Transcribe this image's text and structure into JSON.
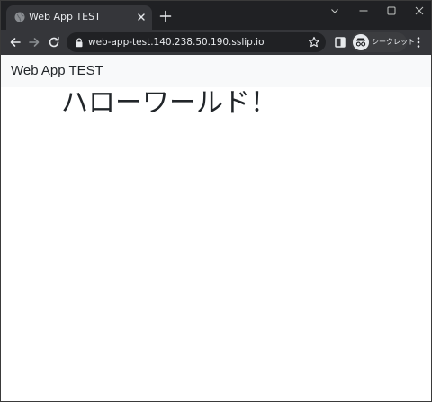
{
  "browser": {
    "tab": {
      "title": "Web App TEST",
      "favicon": "globe-icon"
    },
    "address_bar": {
      "url": "web-app-test.140.238.50.190.sslip.io"
    },
    "profile": {
      "label": "シークレット",
      "icon": "incognito-icon"
    },
    "colors": {
      "frame": "#202124",
      "toolbar": "#35363a",
      "text": "#e8eaed"
    }
  },
  "page": {
    "navbar": {
      "brand": "Web App TEST",
      "background": "#f8f9fa"
    },
    "heading": "ハローワールド！"
  }
}
